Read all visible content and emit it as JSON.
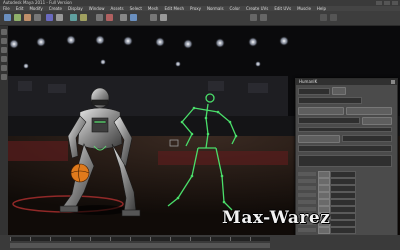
{
  "app": {
    "title": "Autodesk Maya 2011 - Full Version",
    "menus": [
      "File",
      "Edit",
      "Modify",
      "Create",
      "Display",
      "Window",
      "Assets",
      "Select",
      "Mesh",
      "Edit Mesh",
      "Proxy",
      "Normals",
      "Color",
      "Create UVs",
      "Edit UVs",
      "Muscle",
      "Help"
    ]
  },
  "panel": {
    "title": "HumanIK"
  },
  "watermark": {
    "text": "Max-Warez"
  },
  "colors": {
    "skeleton": "#4ade6a",
    "ball": "#e07a1c",
    "panel": "#4b4b4b",
    "background": "#0b0b0b"
  },
  "icons": [
    "window-minimize-icon",
    "window-maximize-icon",
    "window-close-icon",
    "tool-icons",
    "panel-close-icon"
  ]
}
